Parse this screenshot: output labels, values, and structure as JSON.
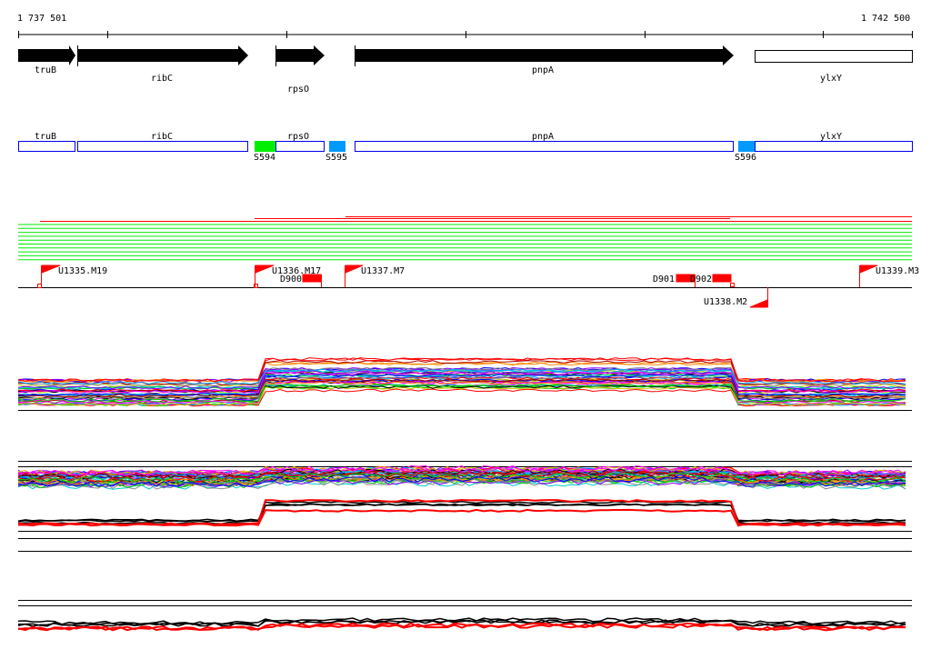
{
  "ruler": {
    "start_label": "1 737 501",
    "end_label": "1 742 500"
  },
  "genes": [
    {
      "name": "truB",
      "start": 20,
      "end": 82,
      "filled": true
    },
    {
      "name": "ribC",
      "start": 86,
      "end": 273,
      "filled": true
    },
    {
      "name": "rpsO",
      "start": 303,
      "end": 357,
      "filled": true
    },
    {
      "name": "pnpA",
      "start": 390,
      "end": 807,
      "filled": true
    },
    {
      "name": "ylxY",
      "start": 830,
      "end": 1003,
      "filled": false
    }
  ],
  "segments": [
    {
      "label": "S594",
      "color": "#00ee00"
    },
    {
      "label": "S595",
      "color": "#0099ff"
    },
    {
      "label": "S596",
      "color": "#0099ff"
    }
  ],
  "features": [
    {
      "label": "U1335.M19"
    },
    {
      "label": "U1336.M17"
    },
    {
      "label": "D900"
    },
    {
      "label": "U1337.M7"
    },
    {
      "label": "D901"
    },
    {
      "label": "D902"
    },
    {
      "label": "U1338.M2"
    },
    {
      "label": "U1339.M3"
    }
  ],
  "colors": {
    "gene_box": "#0000ee",
    "flag": "#ff0000",
    "track_green": "#00ee00",
    "track_red": "#ff0000"
  }
}
